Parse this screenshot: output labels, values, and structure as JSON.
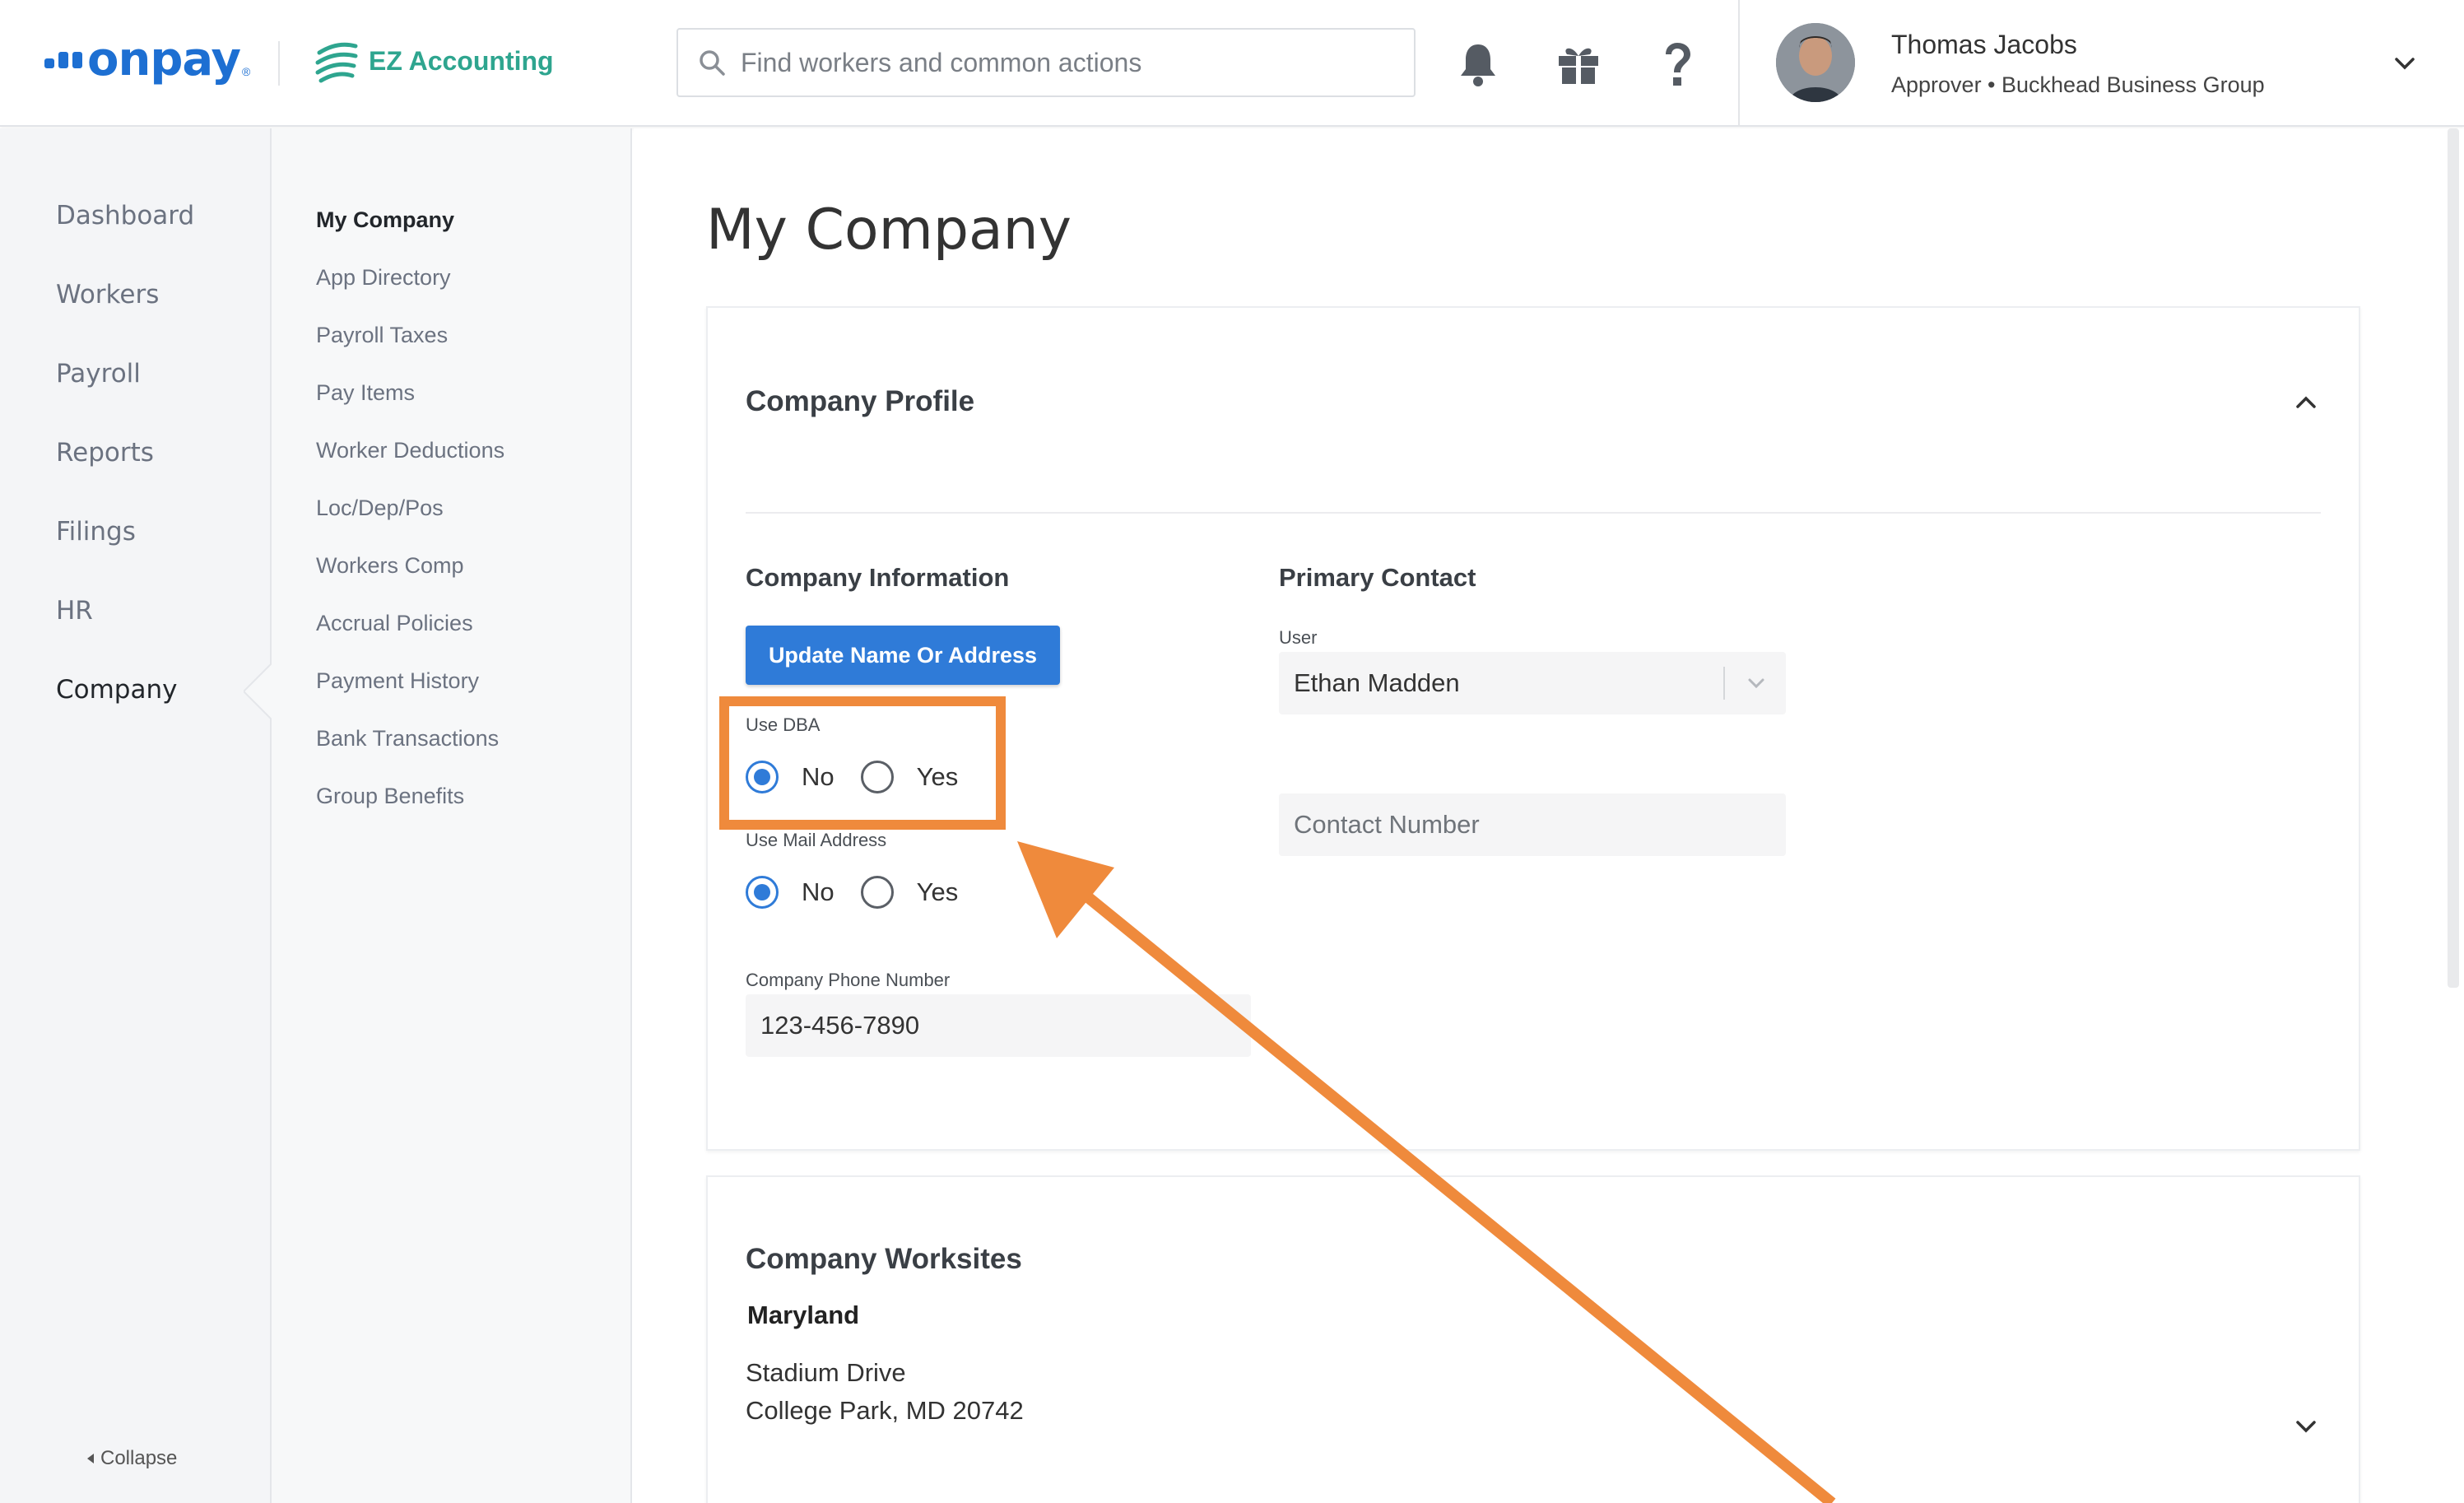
{
  "header": {
    "logo_text": "onpay",
    "logo_mark": "®",
    "partner_name": "EZ Accounting",
    "search_placeholder": "Find workers and common actions",
    "user_name": "Thomas Jacobs",
    "user_role": "Approver • Buckhead Business Group"
  },
  "left_nav": {
    "items": [
      {
        "label": "Dashboard"
      },
      {
        "label": "Workers"
      },
      {
        "label": "Payroll"
      },
      {
        "label": "Reports"
      },
      {
        "label": "Filings"
      },
      {
        "label": "HR"
      },
      {
        "label": "Company"
      }
    ],
    "active": "Company",
    "collapse_label": "Collapse"
  },
  "sub_nav": {
    "items": [
      {
        "label": "My Company"
      },
      {
        "label": "App Directory"
      },
      {
        "label": "Payroll Taxes"
      },
      {
        "label": "Pay Items"
      },
      {
        "label": "Worker Deductions"
      },
      {
        "label": "Loc/Dep/Pos"
      },
      {
        "label": "Workers Comp"
      },
      {
        "label": "Accrual Policies"
      },
      {
        "label": "Payment History"
      },
      {
        "label": "Bank Transactions"
      },
      {
        "label": "Group Benefits"
      }
    ],
    "active": "My Company"
  },
  "main": {
    "page_title": "My Company",
    "profile_card": {
      "title": "Company Profile",
      "company_info": {
        "title": "Company Information",
        "update_button": "Update Name Or Address",
        "use_dba": {
          "label": "Use DBA",
          "options": [
            "No",
            "Yes"
          ],
          "selected": "No"
        },
        "use_mail": {
          "label": "Use Mail Address",
          "options": [
            "No",
            "Yes"
          ],
          "selected": "No"
        },
        "phone": {
          "label": "Company Phone Number",
          "value": "123-456-7890"
        }
      },
      "primary_contact": {
        "title": "Primary Contact",
        "user_label": "User",
        "user_value": "Ethan Madden",
        "contact_placeholder": "Contact Number"
      }
    },
    "worksites_card": {
      "title": "Company Worksites",
      "state": "Maryland",
      "address_line1": "Stadium Drive",
      "address_line2": "College Park, MD 20742"
    }
  },
  "colors": {
    "brand_blue": "#1d6fd2",
    "accent_blue": "#2f7bd8",
    "partner_green": "#2ea58f",
    "annotation_orange": "#ef8a3c"
  }
}
